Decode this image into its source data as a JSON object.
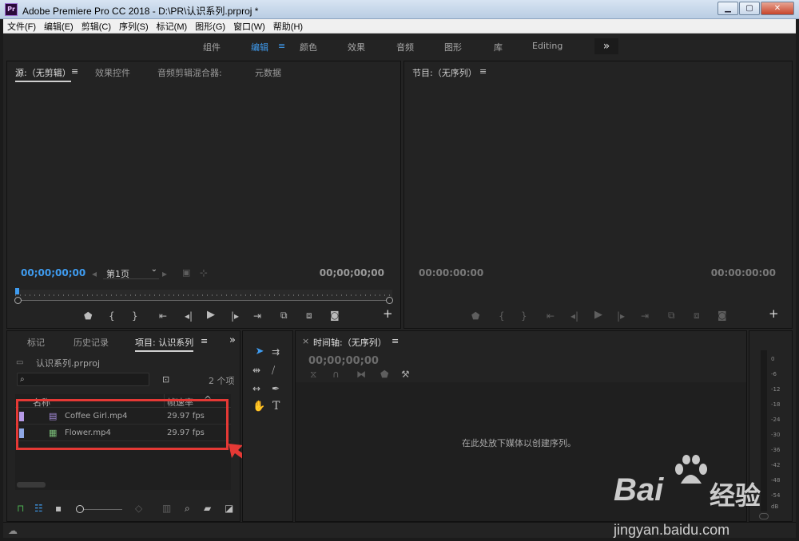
{
  "window": {
    "title": "Adobe Premiere Pro CC 2018 - D:\\PR\\认识系列.prproj *",
    "app_icon_text": "Pr",
    "minimize_symbol": "▁",
    "maximize_symbol": "▢",
    "close_symbol": "✕"
  },
  "menu": [
    "文件(F)",
    "编辑(E)",
    "剪辑(C)",
    "序列(S)",
    "标记(M)",
    "图形(G)",
    "窗口(W)",
    "帮助(H)"
  ],
  "workspaces": {
    "tabs": [
      "组件",
      "编辑",
      "颜色",
      "效果",
      "音频",
      "图形",
      "库",
      "Editing"
    ],
    "active": "编辑",
    "menu_symbol": "≡",
    "overflow_symbol": "»"
  },
  "source_panel": {
    "tabs": [
      "源:（无剪辑）",
      "效果控件",
      "音频剪辑混合器:",
      "元数据"
    ],
    "menu_symbol": "≡",
    "timecode_left": "00;00;00;00",
    "timecode_right": "00;00;00;00",
    "page_label": "第1页",
    "dropdown_symbol": "⌄",
    "add_symbol": "+"
  },
  "program_panel": {
    "tab": "节目:（无序列）",
    "menu_symbol": "≡",
    "timecode_left": "00:00:00:00",
    "timecode_right": "00:00:00:00",
    "add_symbol": "+"
  },
  "project_panel": {
    "tabs": [
      "标记",
      "历史记录",
      "项目: 认识系列"
    ],
    "menu_symbol": "≡",
    "overflow_symbol": "»",
    "project_file": "认识系列.prproj",
    "search_placeholder": "",
    "item_count": "2 个项",
    "columns": {
      "name": "名称",
      "framerate": "帧速率"
    },
    "sort_symbol": "^",
    "items": [
      {
        "name": "Coffee Girl.mp4",
        "fps": "29.97 fps",
        "label_color": "#b79be8"
      },
      {
        "name": "Flower.mp4",
        "fps": "29.97 fps",
        "label_color": "#8fa8e6"
      }
    ]
  },
  "timeline_panel": {
    "close_symbol": "×",
    "tab": "时间轴:（无序列）",
    "menu_symbol": "≡",
    "timecode": "00;00;00;00",
    "drop_hint": "在此处放下媒体以创建序列。"
  },
  "tools": {
    "type_tool": "T"
  },
  "audio_meter": {
    "labels": [
      "0",
      "-6",
      "-12",
      "-18",
      "-24",
      "-30",
      "-36",
      "-42",
      "-48",
      "-54",
      "dB"
    ]
  },
  "watermark": {
    "brand": "Bai",
    "brand_suffix": "经验",
    "url": "jingyan.baidu.com"
  },
  "colors": {
    "accent": "#3f9cf0",
    "highlight_box": "#e53935",
    "annotation_arrow": "#e53935"
  }
}
